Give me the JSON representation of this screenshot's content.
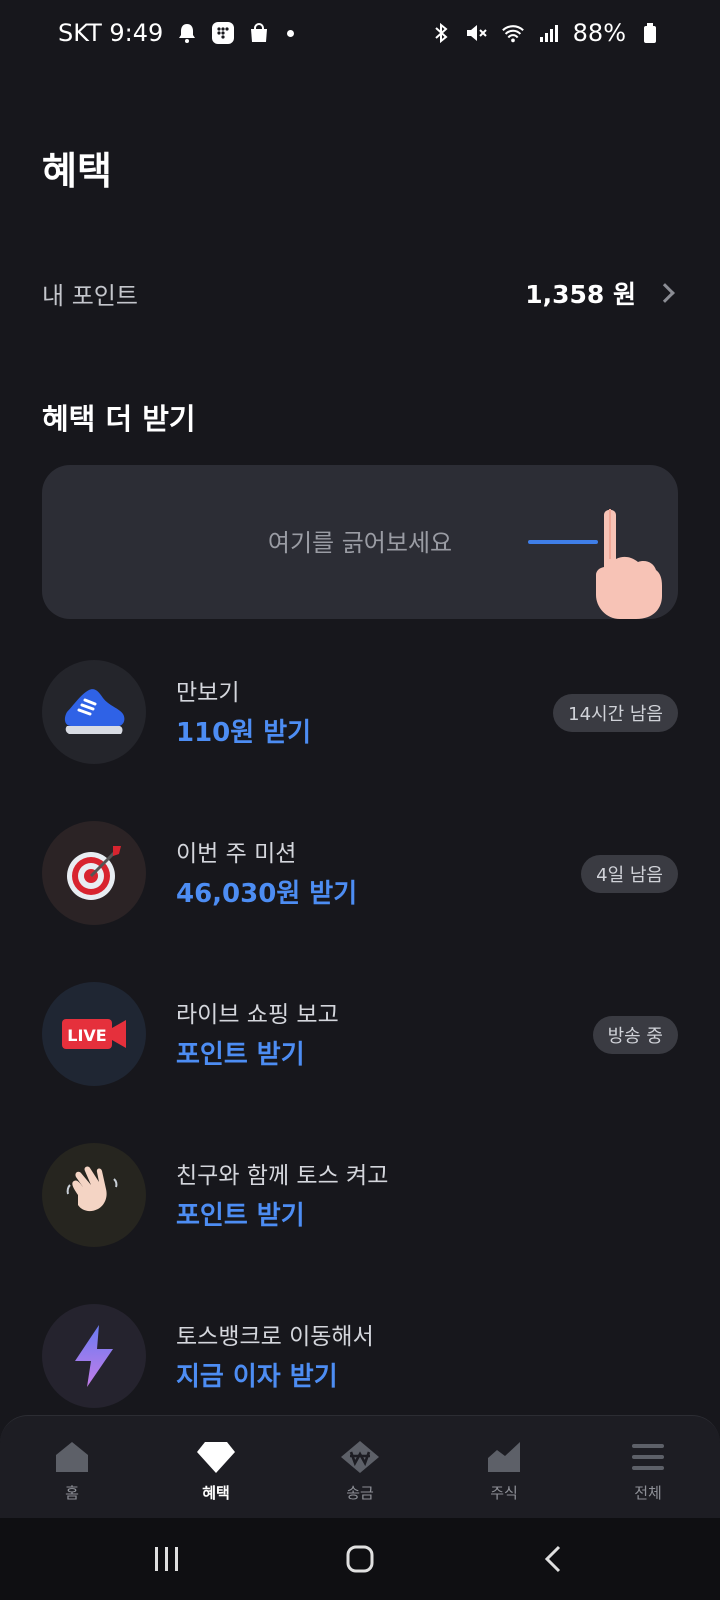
{
  "status_bar": {
    "carrier_time": "SKT 9:49",
    "battery": "88%",
    "left_icons": [
      "bell-icon",
      "app-grid-icon",
      "shopping-bag-icon",
      "dot-icon"
    ],
    "right_icons": [
      "bluetooth-icon",
      "mute-icon",
      "wifi-icon",
      "signal-icon",
      "battery-icon"
    ]
  },
  "page": {
    "title": "혜택"
  },
  "points": {
    "label": "내 포인트",
    "value": "1,358 원"
  },
  "section": {
    "title": "혜택 더 받기"
  },
  "scratch": {
    "label": "여기를 긁어보세요"
  },
  "benefits": [
    {
      "title": "만보기",
      "action": "110원 받기",
      "badge": "14시간 남음",
      "icon": "sneaker-icon"
    },
    {
      "title": "이번 주 미션",
      "action": "46,030원 받기",
      "badge": "4일 남음",
      "icon": "target-dart-icon"
    },
    {
      "title": "라이브 쇼핑 보고",
      "action": "포인트 받기",
      "badge": "방송 중",
      "icon": "live-camera-icon"
    },
    {
      "title": "친구와 함께 토스 켜고",
      "action": "포인트 받기",
      "badge": "",
      "icon": "waving-hand-icon"
    },
    {
      "title": "토스뱅크로 이동해서",
      "action": "지금 이자 받기",
      "badge": "",
      "icon": "lightning-icon"
    }
  ],
  "bottom_nav": [
    {
      "label": "홈",
      "icon": "home-icon",
      "active": false
    },
    {
      "label": "혜택",
      "icon": "gem-icon",
      "active": true
    },
    {
      "label": "송금",
      "icon": "won-transfer-icon",
      "active": false
    },
    {
      "label": "주식",
      "icon": "chart-icon",
      "active": false
    },
    {
      "label": "전체",
      "icon": "menu-icon",
      "active": false
    }
  ],
  "colors": {
    "background": "#17171c",
    "accent": "#4d8df3",
    "card": "#2c2d35",
    "badge": "#3a3b42"
  }
}
